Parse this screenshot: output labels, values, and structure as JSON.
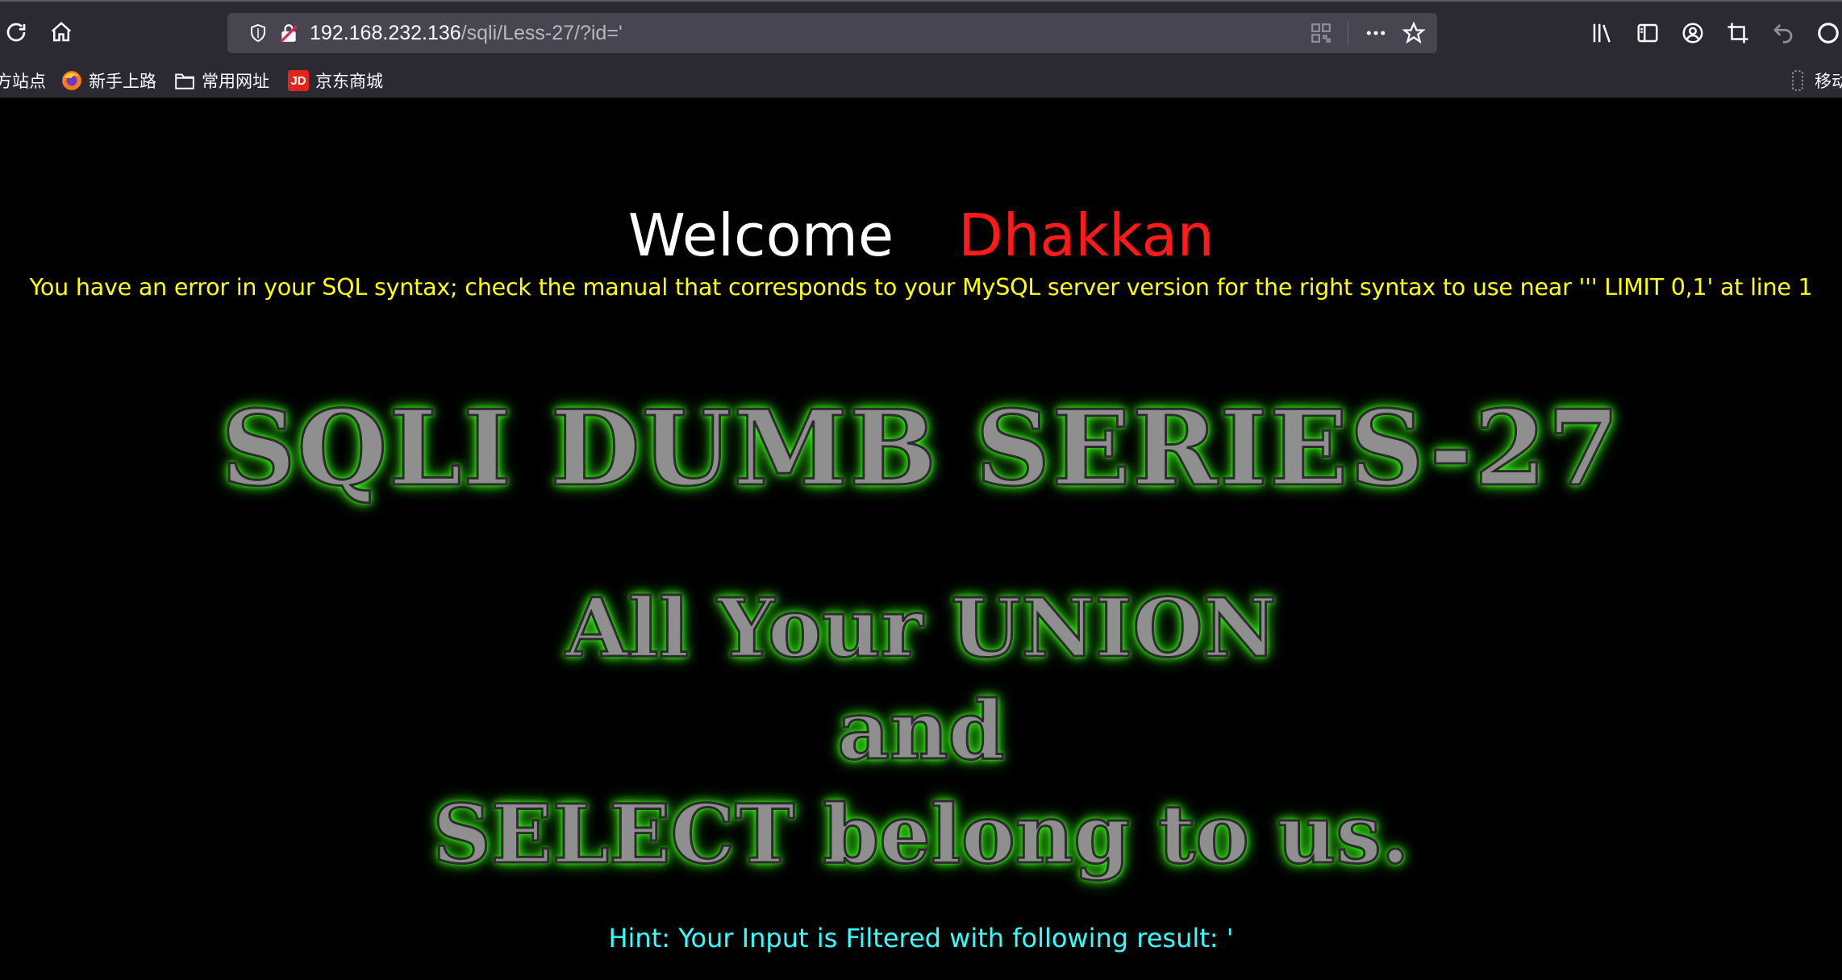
{
  "browser": {
    "url_host": "192.168.232.136",
    "url_path": "/sqli/Less-27/?id='",
    "bookmarks": [
      {
        "label": "方站点"
      },
      {
        "label": "新手上路"
      },
      {
        "label": "常用网址"
      },
      {
        "label": "京东商城",
        "icon_text": "JD"
      }
    ],
    "mobile_bookmarks": "移动",
    "colors": {
      "toolbar": "#2b2a33",
      "urlbar": "#474650"
    }
  },
  "page": {
    "welcome": "Welcome",
    "name": "Dhakkan",
    "error": "You have an error in your SQL syntax; check the manual that corresponds to your MySQL server version for the right syntax to use near ''' LIMIT 0,1' at line 1",
    "banner_title": "SQLI DUMB SERIES-27",
    "banner_line1": "All Your UNION",
    "banner_line2": "and",
    "banner_line3": "SELECT belong to us.",
    "hint": "Hint: Your Input is Filtered with following result: '",
    "colors": {
      "welcome": "#ffffff",
      "name": "#ff1a1a",
      "error": "#ffff00",
      "hint": "#33ffff",
      "glow": "#39ff14"
    }
  }
}
